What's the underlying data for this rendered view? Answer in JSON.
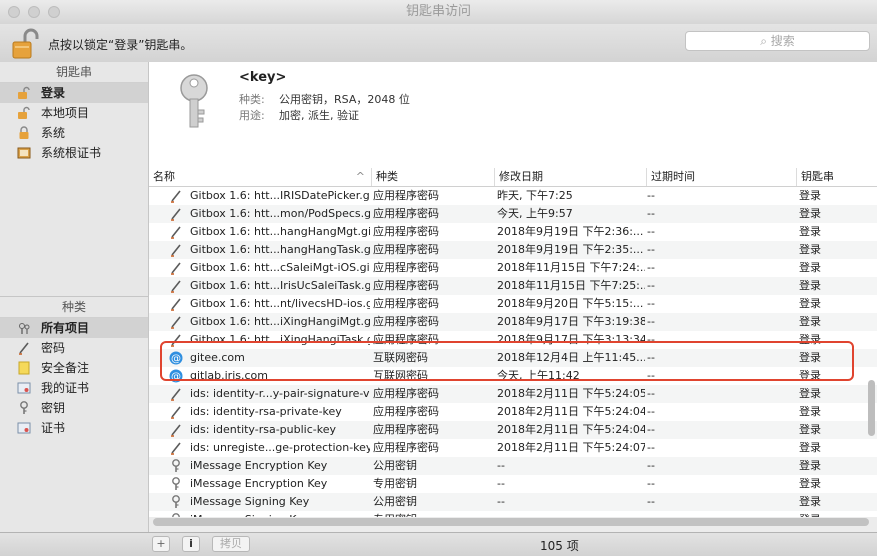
{
  "window": {
    "title": "钥匙串访问"
  },
  "toolbar": {
    "lock_text": "点按以锁定“登录”钥匙串。",
    "search_placeholder": "搜索"
  },
  "sidebar": {
    "keychains_header": "钥匙串",
    "keychains": [
      {
        "label": "登录",
        "icon": "lock-open-icon",
        "selected": true
      },
      {
        "label": "本地项目",
        "icon": "lock-open-icon",
        "selected": false
      },
      {
        "label": "系统",
        "icon": "lock-icon",
        "selected": false
      },
      {
        "label": "系统根证书",
        "icon": "cabinet-icon",
        "selected": false
      }
    ],
    "category_header": "种类",
    "categories": [
      {
        "label": "所有项目",
        "icon": "all-items-icon",
        "selected": true
      },
      {
        "label": "密码",
        "icon": "pen-icon",
        "selected": false
      },
      {
        "label": "安全备注",
        "icon": "note-icon",
        "selected": false
      },
      {
        "label": "我的证书",
        "icon": "certificate-icon",
        "selected": false
      },
      {
        "label": "密钥",
        "icon": "key-icon",
        "selected": false
      },
      {
        "label": "证书",
        "icon": "certificate-icon",
        "selected": false
      }
    ]
  },
  "detail": {
    "name": "<key>",
    "kind_label": "种类:",
    "kind_value": "公用密钥，RSA，2048 位",
    "usage_label": "用途:",
    "usage_value": "加密, 派生, 验证"
  },
  "table": {
    "columns": [
      "名称",
      "种类",
      "修改日期",
      "过期时间",
      "钥匙串"
    ],
    "rows": [
      {
        "icon": "pen-icon",
        "name": "Gitbox 1.6: htt...IRISDatePicker.git",
        "kind": "应用程序密码",
        "date": "昨天, 下午7:25",
        "expires": "--",
        "keychain": "登录"
      },
      {
        "icon": "pen-icon",
        "name": "Gitbox 1.6: htt...mon/PodSpecs.git",
        "kind": "应用程序密码",
        "date": "今天, 上午9:57",
        "expires": "--",
        "keychain": "登录"
      },
      {
        "icon": "pen-icon",
        "name": "Gitbox 1.6: htt...hangHangMgt.git",
        "kind": "应用程序密码",
        "date": "2018年9月19日 下午2:36:...",
        "expires": "--",
        "keychain": "登录"
      },
      {
        "icon": "pen-icon",
        "name": "Gitbox 1.6: htt...hangHangTask.git",
        "kind": "应用程序密码",
        "date": "2018年9月19日 下午2:35:...",
        "expires": "--",
        "keychain": "登录"
      },
      {
        "icon": "pen-icon",
        "name": "Gitbox 1.6: htt...cSaleiMgt-iOS.git",
        "kind": "应用程序密码",
        "date": "2018年11月15日 下午7:24:...",
        "expires": "--",
        "keychain": "登录"
      },
      {
        "icon": "pen-icon",
        "name": "Gitbox 1.6: htt...IrisUcSaleiTask.git",
        "kind": "应用程序密码",
        "date": "2018年11月15日 下午7:25:...",
        "expires": "--",
        "keychain": "登录"
      },
      {
        "icon": "pen-icon",
        "name": "Gitbox 1.6: htt...nt/livecsHD-ios.git",
        "kind": "应用程序密码",
        "date": "2018年9月20日 下午5:15:...",
        "expires": "--",
        "keychain": "登录"
      },
      {
        "icon": "pen-icon",
        "name": "Gitbox 1.6: htt...iXingHangiMgt.git",
        "kind": "应用程序密码",
        "date": "2018年9月17日 下午3:19:38",
        "expires": "--",
        "keychain": "登录"
      },
      {
        "icon": "pen-icon",
        "name": "Gitbox 1.6: htt...iXingHangiTask.git",
        "kind": "应用程序密码",
        "date": "2018年9月17日 下午3:13:34",
        "expires": "--",
        "keychain": "登录"
      },
      {
        "icon": "at-icon",
        "name": "gitee.com",
        "kind": "互联网密码",
        "date": "2018年12月4日 上午11:45...",
        "expires": "--",
        "keychain": "登录"
      },
      {
        "icon": "at-icon",
        "name": "gitlab.iris.com",
        "kind": "互联网密码",
        "date": "今天, 上午11:42",
        "expires": "--",
        "keychain": "登录"
      },
      {
        "icon": "pen-icon",
        "name": "ids: identity-r...y-pair-signature-v1",
        "kind": "应用程序密码",
        "date": "2018年2月11日 下午5:24:05",
        "expires": "--",
        "keychain": "登录"
      },
      {
        "icon": "pen-icon",
        "name": "ids: identity-rsa-private-key",
        "kind": "应用程序密码",
        "date": "2018年2月11日 下午5:24:04",
        "expires": "--",
        "keychain": "登录"
      },
      {
        "icon": "pen-icon",
        "name": "ids: identity-rsa-public-key",
        "kind": "应用程序密码",
        "date": "2018年2月11日 下午5:24:04",
        "expires": "--",
        "keychain": "登录"
      },
      {
        "icon": "pen-icon",
        "name": "ids: unregiste...ge-protection-key",
        "kind": "应用程序密码",
        "date": "2018年2月11日 下午5:24:07",
        "expires": "--",
        "keychain": "登录"
      },
      {
        "icon": "key-icon",
        "name": "iMessage Encryption Key",
        "kind": "公用密钥",
        "date": "--",
        "expires": "--",
        "keychain": "登录"
      },
      {
        "icon": "key-icon",
        "name": "iMessage Encryption Key",
        "kind": "专用密钥",
        "date": "--",
        "expires": "--",
        "keychain": "登录"
      },
      {
        "icon": "key-icon",
        "name": "iMessage Signing Key",
        "kind": "公用密钥",
        "date": "--",
        "expires": "--",
        "keychain": "登录"
      },
      {
        "icon": "key-icon",
        "name": "iMessage Signing Key",
        "kind": "专用密钥",
        "date": "--",
        "expires": "--",
        "keychain": "登录"
      }
    ]
  },
  "bottom": {
    "add_label": "+",
    "info_label": "i",
    "copy_label": "拷贝",
    "count_text": "105 项"
  },
  "colors": {
    "highlight": "#e0442f",
    "at_icon": "#2f8fe0",
    "lock": "#e6a23c"
  }
}
